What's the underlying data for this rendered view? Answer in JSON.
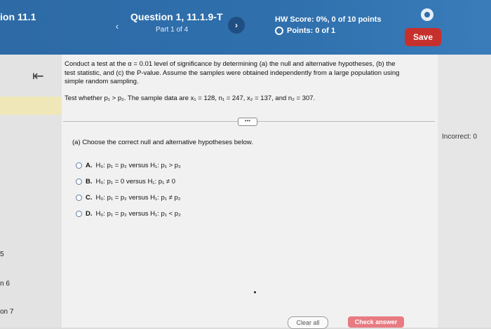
{
  "header": {
    "section": "ion 11.1",
    "question_title": "Question 1, 11.1.9-T",
    "question_part": "Part 1 of 4",
    "hw_score": "HW Score: 0%, 0 of 10 points",
    "points": "Points: 0 of 1",
    "save_label": "Save",
    "prev_icon": "‹",
    "next_icon": "›"
  },
  "sidebar": {
    "back_icon": "⇤",
    "items": [
      "5",
      "n 6",
      "on 7"
    ]
  },
  "prompt": {
    "line1": "Conduct a test at the α = 0.01 level of significance by determining (a) the null and alternative hypotheses, (b) the",
    "line2": "test statistic, and (c) the P-value. Assume the samples were obtained independently from a large population using",
    "line3": "simple random sampling.",
    "test_line": "Test whether p₁ > p₂. The sample data are x₁ = 128, n₁ = 247, x₂ = 137, and n₂ = 307."
  },
  "expand_label": "•••",
  "part_a": {
    "question": "(a) Choose the correct null and alternative hypotheses below.",
    "options": [
      {
        "letter": "A.",
        "text": "H₀: p₁ = p₂ versus H₁: p₁ > p₂"
      },
      {
        "letter": "B.",
        "text": "H₀: p₁ = 0 versus H₁: p₁ ≠ 0"
      },
      {
        "letter": "C.",
        "text": "H₀: p₁ = p₂ versus H₁: p₁ ≠ p₂"
      },
      {
        "letter": "D.",
        "text": "H₀: p₁ = p₂ versus H₁: p₁ < p₂"
      }
    ]
  },
  "right_panel": {
    "incorrect": "Incorrect: 0"
  },
  "footer": {
    "clear_all": "Clear all",
    "check_answer": "Check answer"
  }
}
